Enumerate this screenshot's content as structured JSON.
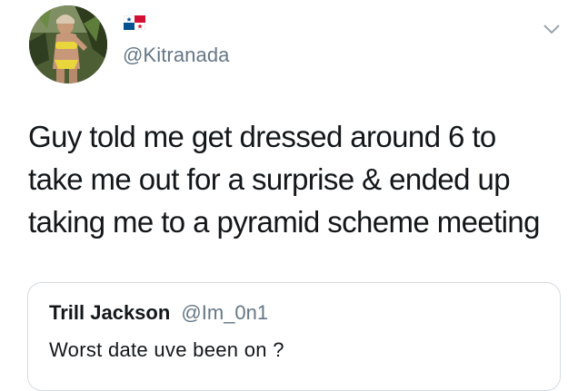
{
  "tweet": {
    "author_handle": "@Kitranada",
    "flag_icon": "panama-flag-icon",
    "text": "Guy told me get dressed around 6 to\ntake me out for a surprise & ended up\ntaking me to a pyramid scheme meeting",
    "menu_icon": "chevron-down-icon"
  },
  "quoted_tweet": {
    "author_name": "Trill Jackson",
    "author_handle": "@Im_0n1",
    "text": "Worst date uve been on ?"
  },
  "colors": {
    "text": "#14171a",
    "secondary": "#657786",
    "border": "#d6dbe0",
    "flag_red": "#d21034",
    "flag_blue": "#005293"
  }
}
